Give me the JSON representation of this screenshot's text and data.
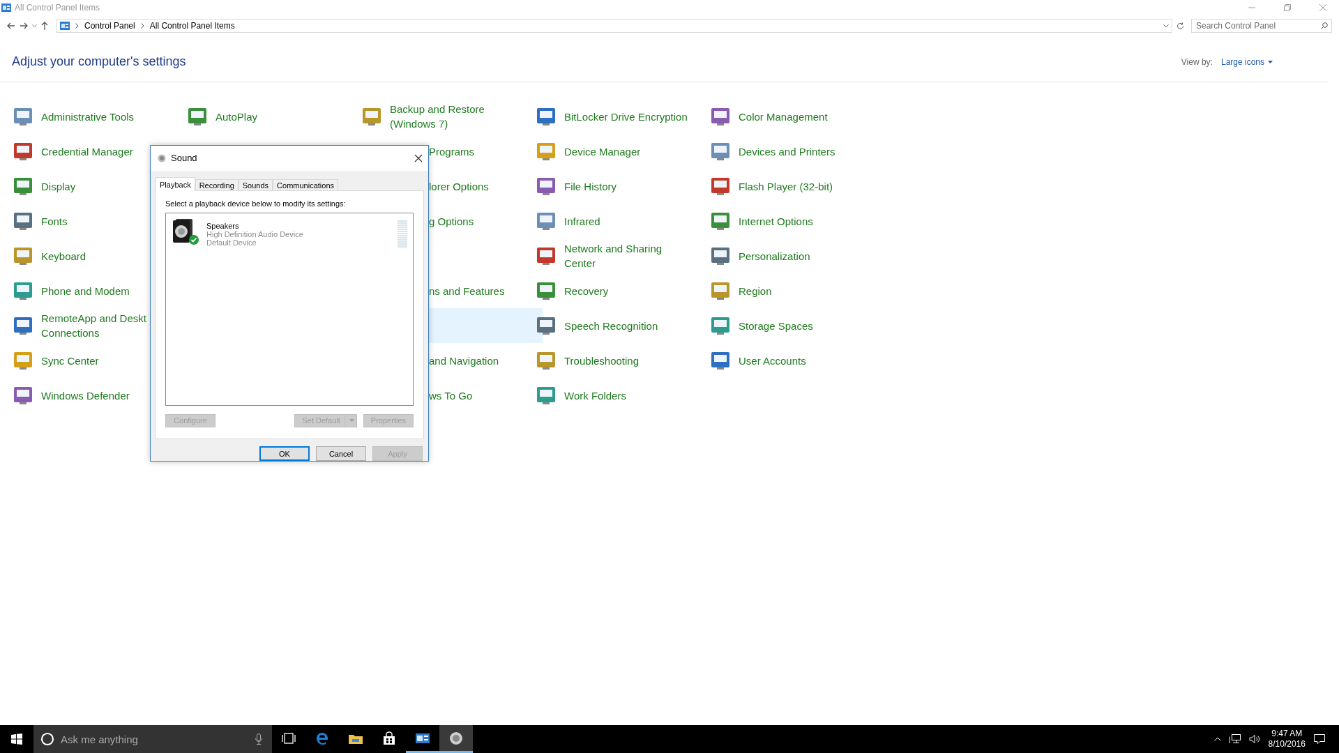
{
  "window": {
    "title": "All Control Panel Items"
  },
  "address_bar": {
    "path": [
      "Control Panel",
      "All Control Panel Items"
    ]
  },
  "search": {
    "placeholder": "Search Control Panel"
  },
  "header": {
    "title": "Adjust your computer's settings",
    "view_by_label": "View by:",
    "view_by_value": "Large icons"
  },
  "grid": [
    [
      {
        "kind": "applet",
        "label": "Administrative Tools"
      },
      {
        "kind": "applet",
        "label": "AutoPlay"
      },
      {
        "kind": "applet",
        "label": "Backup and Restore\n(Windows 7)"
      },
      {
        "kind": "applet",
        "label": "BitLocker Drive Encryption"
      },
      {
        "kind": "applet",
        "label": "Color Management"
      }
    ],
    [
      {
        "kind": "applet",
        "label": "Credential Manager"
      },
      {
        "kind": "hidden"
      },
      {
        "kind": "cut",
        "label": "Programs"
      },
      {
        "kind": "applet",
        "label": "Device Manager"
      },
      {
        "kind": "applet",
        "label": "Devices and Printers"
      }
    ],
    [
      {
        "kind": "applet",
        "label": "Display"
      },
      {
        "kind": "hidden"
      },
      {
        "kind": "cut",
        "label": "lorer Options"
      },
      {
        "kind": "applet",
        "label": "File History"
      },
      {
        "kind": "applet",
        "label": "Flash Player (32-bit)"
      }
    ],
    [
      {
        "kind": "applet",
        "label": "Fonts"
      },
      {
        "kind": "hidden"
      },
      {
        "kind": "cut",
        "label": "g Options"
      },
      {
        "kind": "applet",
        "label": "Infrared"
      },
      {
        "kind": "applet",
        "label": "Internet Options"
      }
    ],
    [
      {
        "kind": "applet",
        "label": "Keyboard"
      },
      {
        "kind": "hidden"
      },
      {
        "kind": "hidden"
      },
      {
        "kind": "applet",
        "label": "Network and Sharing\nCenter"
      },
      {
        "kind": "applet",
        "label": "Personalization"
      }
    ],
    [
      {
        "kind": "applet",
        "label": "Phone and Modem"
      },
      {
        "kind": "hidden"
      },
      {
        "kind": "cut",
        "label": "ns and Features"
      },
      {
        "kind": "applet",
        "label": "Recovery"
      },
      {
        "kind": "applet",
        "label": "Region"
      }
    ],
    [
      {
        "kind": "applet",
        "label": "RemoteApp and Deskt\nConnections"
      },
      {
        "kind": "hidden"
      },
      {
        "kind": "hidden",
        "highlighted": true
      },
      {
        "kind": "applet",
        "label": "Speech Recognition"
      },
      {
        "kind": "applet",
        "label": "Storage Spaces"
      }
    ],
    [
      {
        "kind": "applet",
        "label": "Sync Center"
      },
      {
        "kind": "hidden"
      },
      {
        "kind": "cut",
        "label": "and Navigation"
      },
      {
        "kind": "applet",
        "label": "Troubleshooting"
      },
      {
        "kind": "applet",
        "label": "User Accounts"
      }
    ],
    [
      {
        "kind": "applet",
        "label": "Windows Defender"
      },
      {
        "kind": "hidden"
      },
      {
        "kind": "cut",
        "label": "ws To Go"
      },
      {
        "kind": "applet",
        "label": "Work Folders"
      }
    ]
  ],
  "dialog": {
    "title": "Sound",
    "tabs": [
      {
        "label": "Playback",
        "selected": true
      },
      {
        "label": "Recording",
        "selected": false
      },
      {
        "label": "Sounds",
        "selected": false
      },
      {
        "label": "Communications",
        "selected": false
      }
    ],
    "instruction": "Select a playback device below to modify its settings:",
    "devices": [
      {
        "name": "Speakers",
        "description": "High Definition Audio Device",
        "status": "Default Device",
        "default": true,
        "level": 0
      }
    ],
    "device_buttons": [
      {
        "label": "Configure",
        "disabled": true
      },
      {
        "label": "Set Default",
        "disabled": true,
        "split": true
      },
      {
        "label": "Properties",
        "disabled": true
      }
    ],
    "buttons": [
      {
        "label": "OK",
        "disabled": false,
        "default": true
      },
      {
        "label": "Cancel",
        "disabled": false,
        "default": false
      },
      {
        "label": "Apply",
        "disabled": true,
        "default": false
      }
    ]
  },
  "taskbar": {
    "search_placeholder": "Ask me anything",
    "apps": [
      {
        "kind": "taskview",
        "running": false,
        "selected": false
      },
      {
        "kind": "edge",
        "running": false,
        "selected": false
      },
      {
        "kind": "explorer",
        "running": false,
        "selected": false
      },
      {
        "kind": "store",
        "running": false,
        "selected": false
      },
      {
        "kind": "controlpanel",
        "running": true,
        "selected": false
      },
      {
        "kind": "sound",
        "running": true,
        "selected": true
      }
    ],
    "time": "9:47 AM",
    "date": "8/10/2016"
  }
}
